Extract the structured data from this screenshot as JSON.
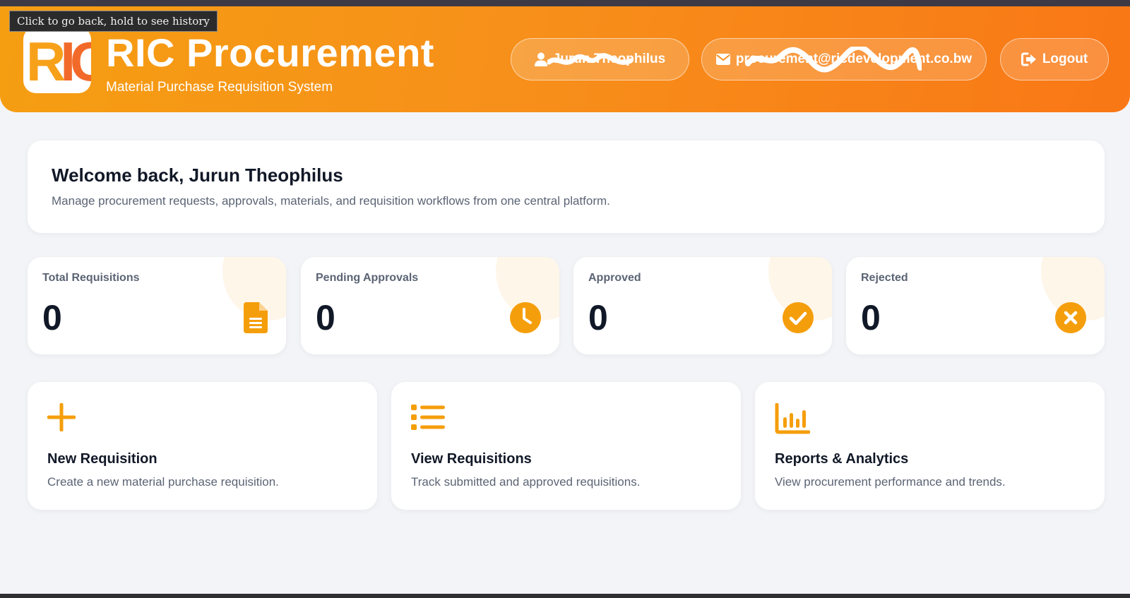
{
  "tooltip": "Click to go back, hold to see history",
  "header": {
    "logo_letters": "RIC",
    "title": "RIC Procurement",
    "subtitle": "Material Purchase Requisition System",
    "user_name": "Jurun Theophilus",
    "email": "procurement@ricdevelopment.co.bw",
    "logout_label": "Logout"
  },
  "welcome": {
    "title": "Welcome back, Jurun Theophilus",
    "text": "Manage procurement requests, approvals, materials, and requisition workflows from one central platform."
  },
  "stats": [
    {
      "label": "Total Requisitions",
      "value": "0",
      "icon": "document-icon"
    },
    {
      "label": "Pending Approvals",
      "value": "0",
      "icon": "clock-icon"
    },
    {
      "label": "Approved",
      "value": "0",
      "icon": "check-circle-icon"
    },
    {
      "label": "Rejected",
      "value": "0",
      "icon": "x-circle-icon"
    }
  ],
  "actions": [
    {
      "title": "New Requisition",
      "text": "Create a new material purchase requisition.",
      "icon": "plus-icon"
    },
    {
      "title": "View Requisitions",
      "text": "Track submitted and approved requisitions.",
      "icon": "list-icon"
    },
    {
      "title": "Reports & Analytics",
      "text": "View procurement performance and trends.",
      "icon": "bar-chart-icon"
    }
  ],
  "colors": {
    "accent": "#f59e0b",
    "header_start": "#f59e12",
    "header_end": "#f97716",
    "text_dark": "#111827",
    "text_muted": "#5b6474",
    "background": "#f3f4f7"
  }
}
